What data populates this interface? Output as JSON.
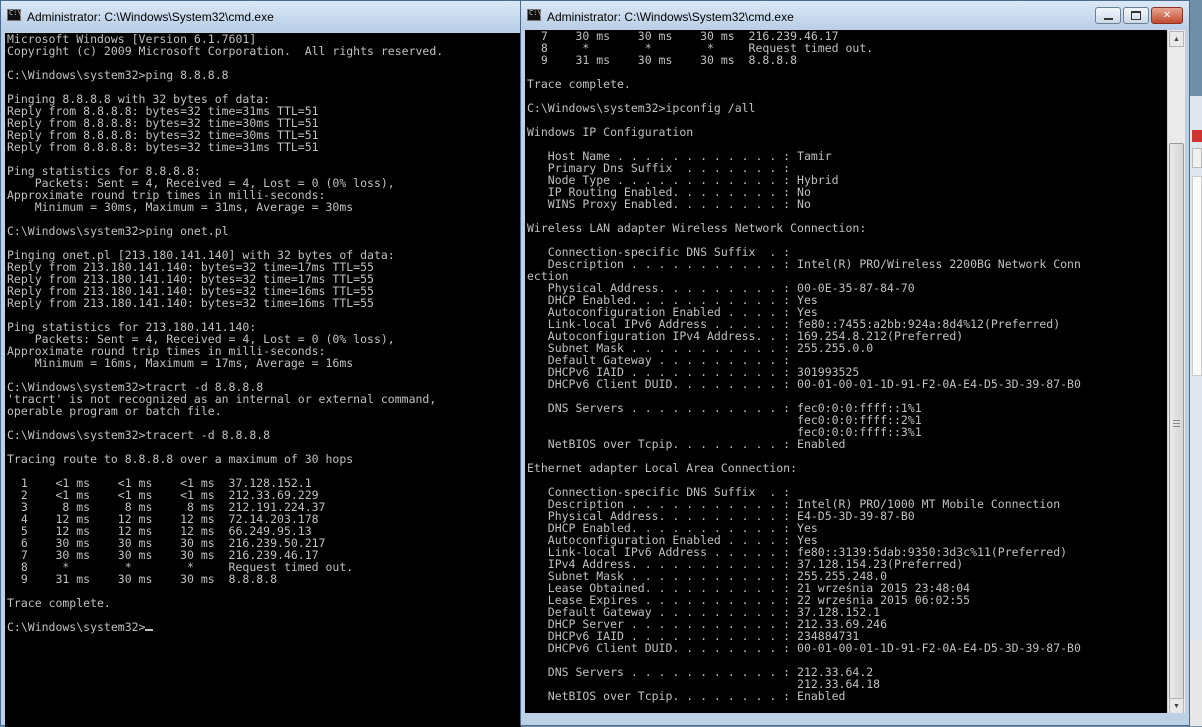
{
  "left_window": {
    "title": "Administrator: C:\\Windows\\System32\\cmd.exe",
    "lines": [
      "Microsoft Windows [Version 6.1.7601]",
      "Copyright (c) 2009 Microsoft Corporation.  All rights reserved.",
      "",
      "C:\\Windows\\system32>ping 8.8.8.8",
      "",
      "Pinging 8.8.8.8 with 32 bytes of data:",
      "Reply from 8.8.8.8: bytes=32 time=31ms TTL=51",
      "Reply from 8.8.8.8: bytes=32 time=30ms TTL=51",
      "Reply from 8.8.8.8: bytes=32 time=30ms TTL=51",
      "Reply from 8.8.8.8: bytes=32 time=31ms TTL=51",
      "",
      "Ping statistics for 8.8.8.8:",
      "    Packets: Sent = 4, Received = 4, Lost = 0 (0% loss),",
      "Approximate round trip times in milli-seconds:",
      "    Minimum = 30ms, Maximum = 31ms, Average = 30ms",
      "",
      "C:\\Windows\\system32>ping onet.pl",
      "",
      "Pinging onet.pl [213.180.141.140] with 32 bytes of data:",
      "Reply from 213.180.141.140: bytes=32 time=17ms TTL=55",
      "Reply from 213.180.141.140: bytes=32 time=17ms TTL=55",
      "Reply from 213.180.141.140: bytes=32 time=16ms TTL=55",
      "Reply from 213.180.141.140: bytes=32 time=16ms TTL=55",
      "",
      "Ping statistics for 213.180.141.140:",
      "    Packets: Sent = 4, Received = 4, Lost = 0 (0% loss),",
      "Approximate round trip times in milli-seconds:",
      "    Minimum = 16ms, Maximum = 17ms, Average = 16ms",
      "",
      "C:\\Windows\\system32>tracrt -d 8.8.8.8",
      "'tracrt' is not recognized as an internal or external command,",
      "operable program or batch file.",
      "",
      "C:\\Windows\\system32>tracert -d 8.8.8.8",
      "",
      "Tracing route to 8.8.8.8 over a maximum of 30 hops",
      "",
      "  1    <1 ms    <1 ms    <1 ms  37.128.152.1",
      "  2    <1 ms    <1 ms    <1 ms  212.33.69.229",
      "  3     8 ms     8 ms     8 ms  212.191.224.37",
      "  4    12 ms    12 ms    12 ms  72.14.203.178",
      "  5    12 ms    12 ms    12 ms  66.249.95.13",
      "  6    30 ms    30 ms    30 ms  216.239.50.217",
      "  7    30 ms    30 ms    30 ms  216.239.46.17",
      "  8     *        *        *     Request timed out.",
      "  9    31 ms    30 ms    30 ms  8.8.8.8",
      "",
      "Trace complete.",
      ""
    ],
    "prompt": "C:\\Windows\\system32>"
  },
  "right_window": {
    "title": "Administrator: C:\\Windows\\System32\\cmd.exe",
    "caption_buttons": {
      "minimize": "minimize-icon",
      "maximize": "maximize-icon",
      "close": "close-icon"
    },
    "lines": [
      "  7    30 ms    30 ms    30 ms  216.239.46.17",
      "  8     *        *        *     Request timed out.",
      "  9    31 ms    30 ms    30 ms  8.8.8.8",
      "",
      "Trace complete.",
      "",
      "C:\\Windows\\system32>ipconfig /all",
      "",
      "Windows IP Configuration",
      "",
      "   Host Name . . . . . . . . . . . . : Tamir",
      "   Primary Dns Suffix  . . . . . . . :",
      "   Node Type . . . . . . . . . . . . : Hybrid",
      "   IP Routing Enabled. . . . . . . . : No",
      "   WINS Proxy Enabled. . . . . . . . : No",
      "",
      "Wireless LAN adapter Wireless Network Connection:",
      "",
      "   Connection-specific DNS Suffix  . :",
      "   Description . . . . . . . . . . . : Intel(R) PRO/Wireless 2200BG Network Conn",
      "ection",
      "   Physical Address. . . . . . . . . : 00-0E-35-87-84-70",
      "   DHCP Enabled. . . . . . . . . . . : Yes",
      "   Autoconfiguration Enabled . . . . : Yes",
      "   Link-local IPv6 Address . . . . . : fe80::7455:a2bb:924a:8d4%12(Preferred)",
      "   Autoconfiguration IPv4 Address. . : 169.254.8.212(Preferred)",
      "   Subnet Mask . . . . . . . . . . . : 255.255.0.0",
      "   Default Gateway . . . . . . . . . :",
      "   DHCPv6 IAID . . . . . . . . . . . : 301993525",
      "   DHCPv6 Client DUID. . . . . . . . : 00-01-00-01-1D-91-F2-0A-E4-D5-3D-39-87-B0",
      "",
      "   DNS Servers . . . . . . . . . . . : fec0:0:0:ffff::1%1",
      "                                       fec0:0:0:ffff::2%1",
      "                                       fec0:0:0:ffff::3%1",
      "   NetBIOS over Tcpip. . . . . . . . : Enabled",
      "",
      "Ethernet adapter Local Area Connection:",
      "",
      "   Connection-specific DNS Suffix  . :",
      "   Description . . . . . . . . . . . : Intel(R) PRO/1000 MT Mobile Connection",
      "   Physical Address. . . . . . . . . : E4-D5-3D-39-87-B0",
      "   DHCP Enabled. . . . . . . . . . . : Yes",
      "   Autoconfiguration Enabled . . . . : Yes",
      "   Link-local IPv6 Address . . . . . : fe80::3139:5dab:9350:3d3c%11(Preferred)",
      "   IPv4 Address. . . . . . . . . . . : 37.128.154.23(Preferred)",
      "   Subnet Mask . . . . . . . . . . . : 255.255.248.0",
      "   Lease Obtained. . . . . . . . . . : 21 września 2015 23:48:04",
      "   Lease Expires . . . . . . . . . . : 22 września 2015 06:02:55",
      "   Default Gateway . . . . . . . . . : 37.128.152.1",
      "   DHCP Server . . . . . . . . . . . : 212.33.69.246",
      "   DHCPv6 IAID . . . . . . . . . . . : 234884731",
      "   DHCPv6 Client DUID. . . . . . . . : 00-01-00-01-1D-91-F2-0A-E4-D5-3D-39-87-B0",
      "",
      "   DNS Servers . . . . . . . . . . . : 212.33.64.2",
      "                                       212.33.64.18",
      "   NetBIOS over Tcpip. . . . . . . . : Enabled"
    ]
  },
  "colors": {
    "console_bg": "#000000",
    "console_fg": "#c0c0c0",
    "title_bar": "#bcd0e6",
    "close_button": "#c24a2f"
  }
}
